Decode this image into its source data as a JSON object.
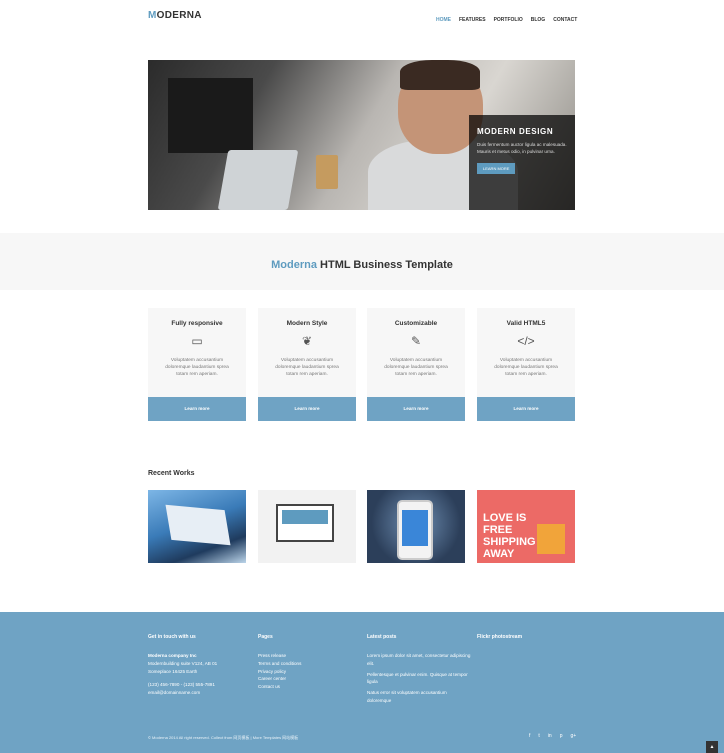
{
  "header": {
    "logo_initial": "M",
    "logo_rest": "ODERNA",
    "nav": [
      "HOME",
      "FEATURES",
      "PORTFOLIO",
      "BLOG",
      "CONTACT"
    ]
  },
  "hero": {
    "caption_title": "MODERN DESIGN",
    "caption_text": "Duis fermentum auctor ligula ac malesuada. Mauris et metus odio, in pulvinar urna.",
    "caption_button": "LEARN MORE"
  },
  "band": {
    "highlight": "Moderna",
    "rest": " HTML Business Template"
  },
  "features": [
    {
      "title": "Fully responsive",
      "icon": "monitor-icon",
      "glyph": "▭",
      "text": "Voluptatem accusantium doloremque laudantium sprea totam rem aperiam.",
      "button": "Learn more"
    },
    {
      "title": "Modern Style",
      "icon": "leaf-icon",
      "glyph": "❦",
      "text": "Voluptatem accusantium doloremque laudantium sprea totam rem aperiam.",
      "button": "Learn more"
    },
    {
      "title": "Customizable",
      "icon": "edit-icon",
      "glyph": "✎",
      "text": "Voluptatem accusantium doloremque laudantium sprea totam rem aperiam.",
      "button": "Learn more"
    },
    {
      "title": "Valid HTML5",
      "icon": "code-icon",
      "glyph": "</>",
      "text": "Voluptatem accusantium doloremque laudantium sprea totam rem aperiam.",
      "button": "Learn more"
    }
  ],
  "recent": {
    "title": "Recent Works",
    "thumb4_text": "LOVE IS FREE SHIPPING AWAY"
  },
  "footer": {
    "col1": {
      "title": "Get in touch with us",
      "company": "Moderna company Inc",
      "address": [
        "Modernbuilding suite V124, AB 01",
        "Someplace 16425 Earth"
      ],
      "phone": "(123) 456-7890 - (123) 555-7891",
      "email": "email@domainname.com"
    },
    "col2": {
      "title": "Pages",
      "links": [
        "Press release",
        "Terms and conditions",
        "Privacy policy",
        "Career center",
        "Contact us"
      ]
    },
    "col3": {
      "title": "Latest posts",
      "posts": [
        "Lorem ipsum dolor sit amet, consectetur adipiscing elit.",
        "Pellentesque et pulvinar enim. Quisque at tempor ligula",
        "Natus error sit voluptatem accusantium doloremque"
      ]
    },
    "col4": {
      "title": "Flickr photostream"
    },
    "copyright": "© Moderna 2014 All right reserved. Collect from 网页模板 | More Templates 网站模板",
    "social": [
      "f",
      "t",
      "in",
      "p",
      "g+"
    ]
  },
  "colors": {
    "accent": "#5e9bbf",
    "footer": "#6fa3c4"
  }
}
